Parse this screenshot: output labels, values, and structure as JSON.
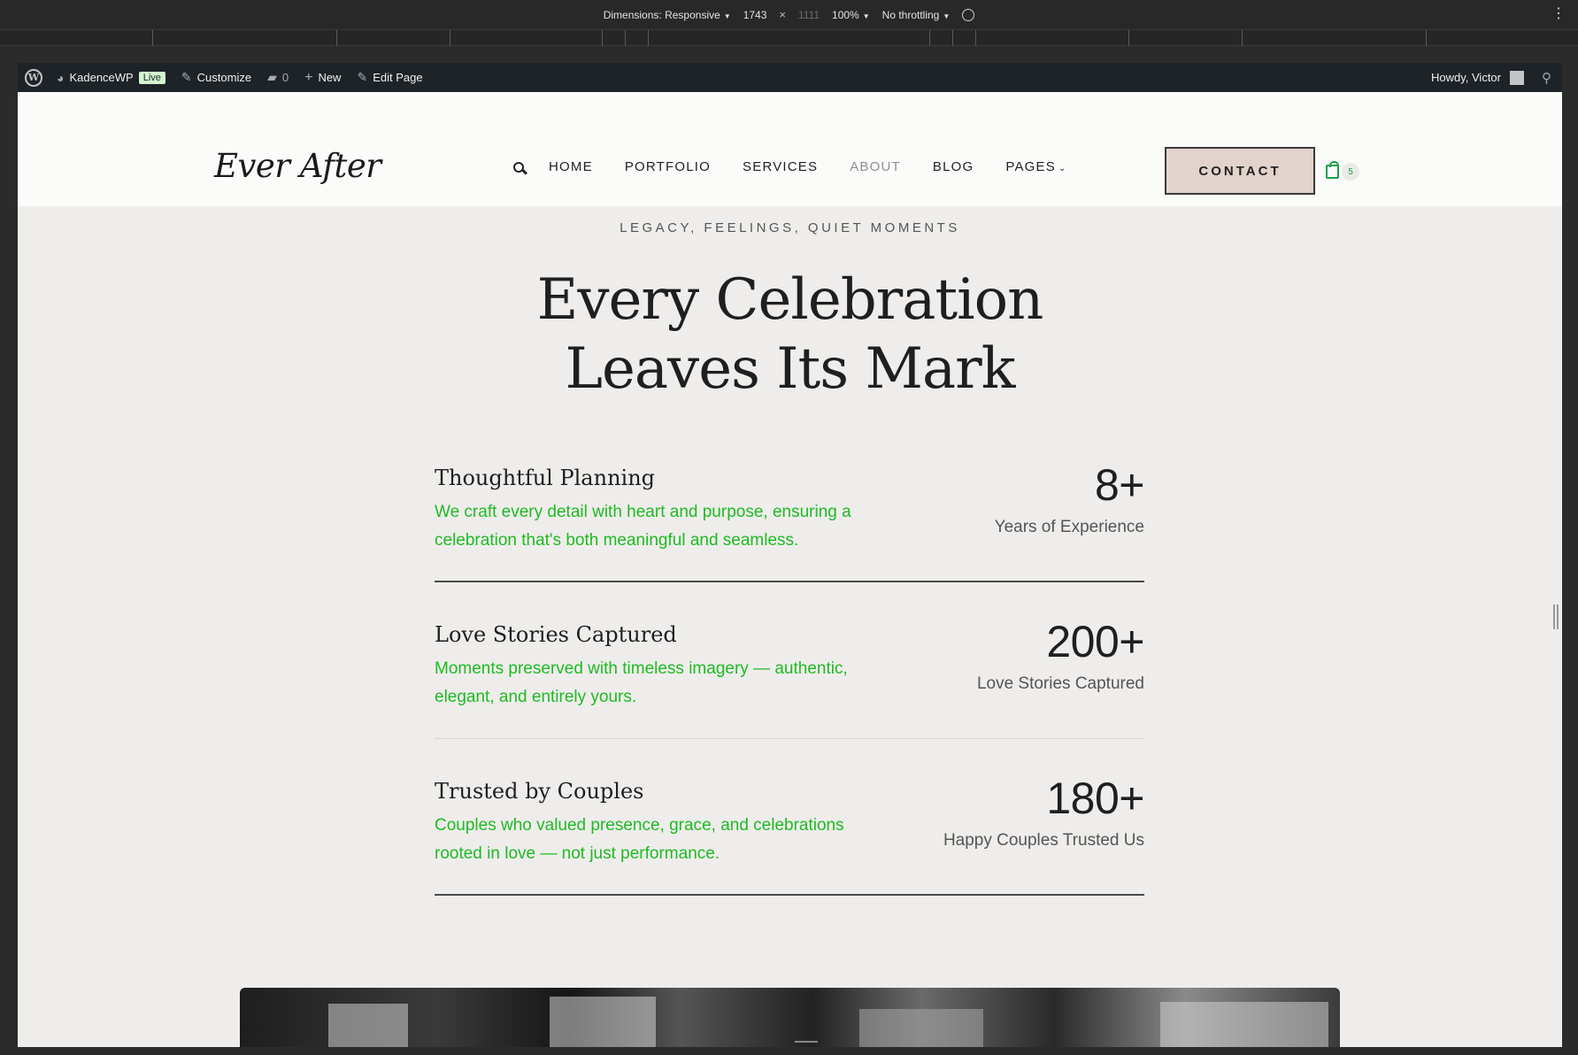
{
  "devtools": {
    "dimensions_label": "Dimensions: Responsive",
    "width": "1743",
    "height": "1111",
    "zoom": "100%",
    "throttling": "No throttling"
  },
  "adminbar": {
    "site_name": "KadenceWP",
    "live_badge": "Live",
    "customize": "Customize",
    "comments_count": "0",
    "new": "New",
    "edit_page": "Edit Page",
    "howdy": "Howdy, Victor"
  },
  "header": {
    "logo": "Ever After",
    "nav": [
      "HOME",
      "PORTFOLIO",
      "SERVICES",
      "ABOUT",
      "BLOG",
      "PAGES"
    ],
    "active_nav": "ABOUT",
    "contact_button": "CONTACT",
    "cart_count": "5",
    "accent_color": "#1aa14a"
  },
  "hero": {
    "kicker": "LEGACY, FEELINGS, QUIET MOMENTS",
    "headline_line1": "Every Celebration",
    "headline_line2": "Leaves Its Mark"
  },
  "stats": [
    {
      "title": "Thoughtful Planning",
      "description": "We craft every detail with heart and purpose, ensuring a celebration that's both meaningful and seamless.",
      "number": "8+",
      "label": "Years of Experience"
    },
    {
      "title": "Love Stories Captured",
      "description": "Moments preserved with timeless imagery — authentic, elegant, and entirely yours.",
      "number": "200+",
      "label": "Love Stories Captured"
    },
    {
      "title": "Trusted by Couples",
      "description": "Couples who valued presence, grace, and celebrations rooted in love — not just performance.",
      "number": "180+",
      "label": "Happy Couples Trusted Us"
    }
  ]
}
